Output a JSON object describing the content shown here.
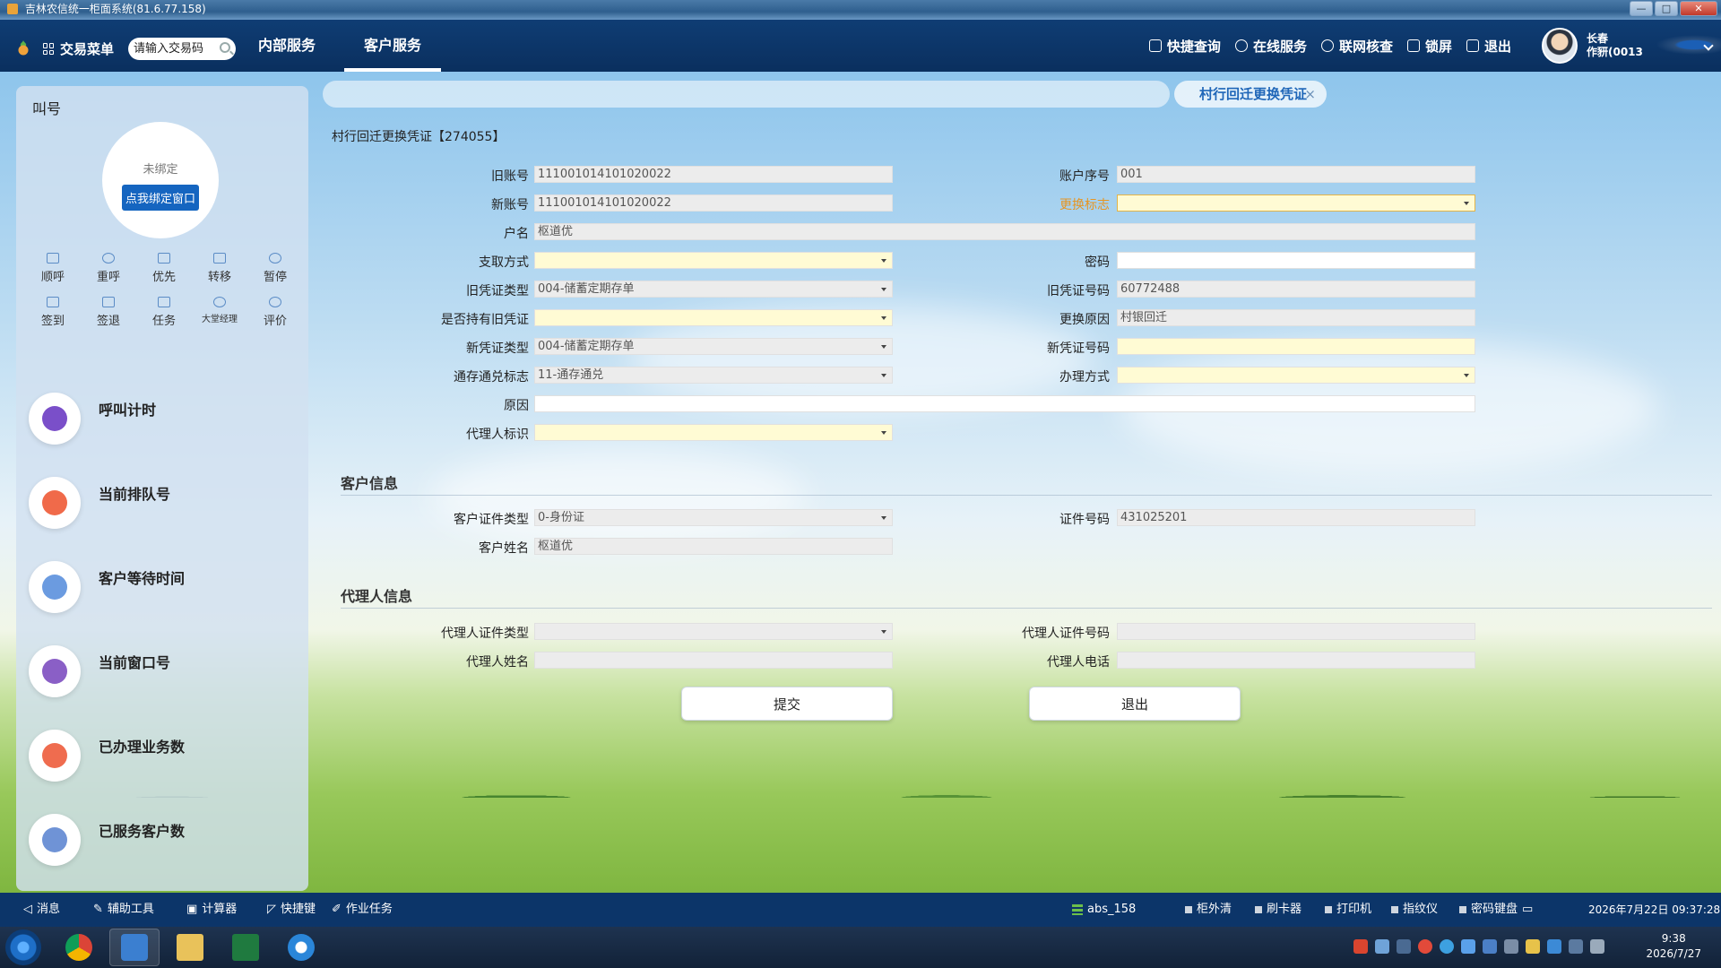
{
  "window": {
    "title": "吉林农信统一柜面系统(81.6.77.158)",
    "controls": [
      "—",
      "□",
      "✕"
    ]
  },
  "topnav": {
    "menu_label": "交易菜单",
    "search_placeholder": "请输入交易码",
    "tabs": [
      {
        "label": "内部服务",
        "active": false
      },
      {
        "label": "客户服务",
        "active": true
      }
    ],
    "right_items": [
      "快捷查询",
      "在线服务",
      "联网核查",
      "锁屏",
      "退出"
    ],
    "user_line1": "长春",
    "user_line2": "作豜(0013"
  },
  "left_panel": {
    "title": "叫号",
    "bind_status": "未绑定",
    "bind_button": "点我绑定窗口",
    "queue_buttons": [
      "顺呼",
      "重呼",
      "优先",
      "转移",
      "暂停",
      "签到",
      "签退",
      "任务",
      "大堂经理",
      "评价"
    ],
    "stats": [
      {
        "label": "呼叫计时",
        "color": "#7a4fc9"
      },
      {
        "label": "当前排队号",
        "color": "#f06a4a"
      },
      {
        "label": "客户等待时间",
        "color": "#6b9be0"
      },
      {
        "label": "当前窗口号",
        "color": "#8a5fc6"
      },
      {
        "label": "已办理业务数",
        "color": "#ef6c4f"
      },
      {
        "label": "已服务客户数",
        "color": "#6f93d6"
      }
    ]
  },
  "form": {
    "tab_label": "村行回迁更换凭证",
    "tab_close": "×",
    "title": "村行回迁更换凭证【274055】",
    "fields": {
      "old_account_label": "旧账号",
      "old_account": "111001014101020022",
      "acct_seq_label": "账户序号",
      "acct_seq": "001",
      "new_account_label": "新账号",
      "new_account": "111001014101020022",
      "change_flag_label": "更换标志",
      "change_flag": "",
      "holder_name_label": "户名",
      "holder_name": "枢道优",
      "withdraw_method_label": "支取方式",
      "withdraw_method": "",
      "password_label": "密码",
      "password": "",
      "old_voucher_type_label": "旧凭证类型",
      "old_voucher_type": "004-储蓄定期存单",
      "old_voucher_no_label": "旧凭证号码",
      "old_voucher_no": "60772488",
      "has_old_voucher_label": "是否持有旧凭证",
      "has_old_voucher": "",
      "change_reason_label": "更换原因",
      "change_reason": "村银回迁",
      "new_voucher_type_label": "新凭证类型",
      "new_voucher_type": "004-储蓄定期存单",
      "new_voucher_no_label": "新凭证号码",
      "new_voucher_no": "",
      "universal_flag_label": "通存通兑标志",
      "universal_flag": "11-通存通兑",
      "handling_method_label": "办理方式",
      "handling_method": "",
      "reason_label": "原因",
      "reason": "",
      "agent_flag_label": "代理人标识",
      "agent_flag": ""
    },
    "customer_section": {
      "title": "客户信息",
      "id_type_label": "客户证件类型",
      "id_type": "0-身份证",
      "id_no_label": "证件号码",
      "id_no": "431025201",
      "name_label": "客户姓名",
      "name": "枢道优"
    },
    "agent_section": {
      "title": "代理人信息",
      "id_type_label": "代理人证件类型",
      "id_type": "",
      "id_no_label": "代理人证件号码",
      "id_no": "",
      "name_label": "代理人姓名",
      "name": "",
      "phone_label": "代理人电话",
      "phone": ""
    },
    "submit_label": "提交",
    "exit_label": "退出"
  },
  "statusbar": {
    "left_items": [
      "消息",
      "辅助工具",
      "计算器",
      "快捷键",
      "作业任务"
    ],
    "terminal": "abs_158",
    "devices": [
      "柜外清",
      "刷卡器",
      "打印机",
      "指纹仪",
      "密码键盘"
    ],
    "datetime": "2026年7月22日 09:37:28"
  },
  "taskbar": {
    "time": "9:38",
    "date": "2026/7/27"
  }
}
